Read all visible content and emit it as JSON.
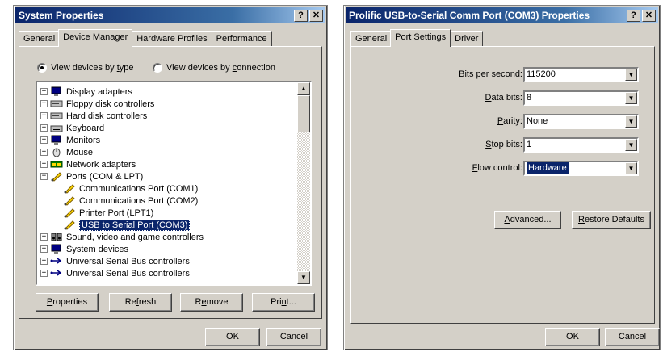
{
  "system_properties": {
    "title": "System Properties",
    "help_btn": "?",
    "close_btn": "✕",
    "tabs": [
      {
        "label": "General"
      },
      {
        "label": "Device Manager"
      },
      {
        "label": "Hardware Profiles"
      },
      {
        "label": "Performance"
      }
    ],
    "view_by_type_pre": "View devices by ",
    "view_by_type_key": "t",
    "view_by_type_post": "ype",
    "view_by_conn_pre": "View devices by ",
    "view_by_conn_key": "c",
    "view_by_conn_post": "onnection",
    "tree": [
      {
        "label": "Display adapters",
        "icon": "monitor-icon",
        "expander": "+"
      },
      {
        "label": "Floppy disk controllers",
        "icon": "disk-icon",
        "expander": "+"
      },
      {
        "label": "Hard disk controllers",
        "icon": "disk-icon",
        "expander": "+"
      },
      {
        "label": "Keyboard",
        "icon": "keyboard-icon",
        "expander": "+"
      },
      {
        "label": "Monitors",
        "icon": "monitor-icon",
        "expander": "+"
      },
      {
        "label": "Mouse",
        "icon": "mouse-icon",
        "expander": "+"
      },
      {
        "label": "Network adapters",
        "icon": "network-icon",
        "expander": "+"
      },
      {
        "label": "Ports (COM & LPT)",
        "icon": "port-icon",
        "expander": "−"
      },
      {
        "label": "Communications Port (COM1)",
        "icon": "port-icon",
        "child": true
      },
      {
        "label": "Communications Port (COM2)",
        "icon": "port-icon",
        "child": true
      },
      {
        "label": "Printer Port (LPT1)",
        "icon": "port-icon",
        "child": true
      },
      {
        "label": "USB to Serial Port (COM3)",
        "icon": "port-icon",
        "child": true,
        "selected": true
      },
      {
        "label": "Sound, video and game controllers",
        "icon": "sound-icon",
        "expander": "+"
      },
      {
        "label": "System devices",
        "icon": "monitor-icon",
        "expander": "+"
      },
      {
        "label": "Universal Serial Bus controllers",
        "icon": "usb-icon",
        "expander": "+"
      },
      {
        "label": "Universal Serial Bus controllers",
        "icon": "usb-icon",
        "expander": "+"
      }
    ],
    "buttons": {
      "properties_key": "P",
      "properties_rest": "roperties",
      "refresh_pre": "Re",
      "refresh_key": "f",
      "refresh_post": "resh",
      "remove_pre": "R",
      "remove_key": "e",
      "remove_post": "move",
      "print_pre": "Pri",
      "print_key": "n",
      "print_post": "t...",
      "ok": "OK",
      "cancel": "Cancel"
    }
  },
  "port_properties": {
    "title": "Prolific USB-to-Serial Comm Port (COM3) Properties",
    "help_btn": "?",
    "close_btn": "✕",
    "tabs": [
      {
        "label": "General"
      },
      {
        "label": "Port Settings"
      },
      {
        "label": "Driver"
      }
    ],
    "fields": [
      {
        "key": "B",
        "rest": "its per second:",
        "value": "115200"
      },
      {
        "key": "D",
        "rest": "ata bits:",
        "value": "8"
      },
      {
        "key": "P",
        "rest": "arity:",
        "value": "None"
      },
      {
        "key": "S",
        "rest": "top bits:",
        "value": "1"
      },
      {
        "key": "F",
        "rest": "low control:",
        "value": "Hardware",
        "selected": true
      }
    ],
    "buttons": {
      "advanced_key": "A",
      "advanced_rest": "dvanced...",
      "restore_key": "R",
      "restore_rest": "estore Defaults",
      "ok": "OK",
      "cancel": "Cancel"
    }
  },
  "colors": {
    "title_active": "#0a246a",
    "face": "#d4d0c8",
    "selection": "#0a246a"
  }
}
